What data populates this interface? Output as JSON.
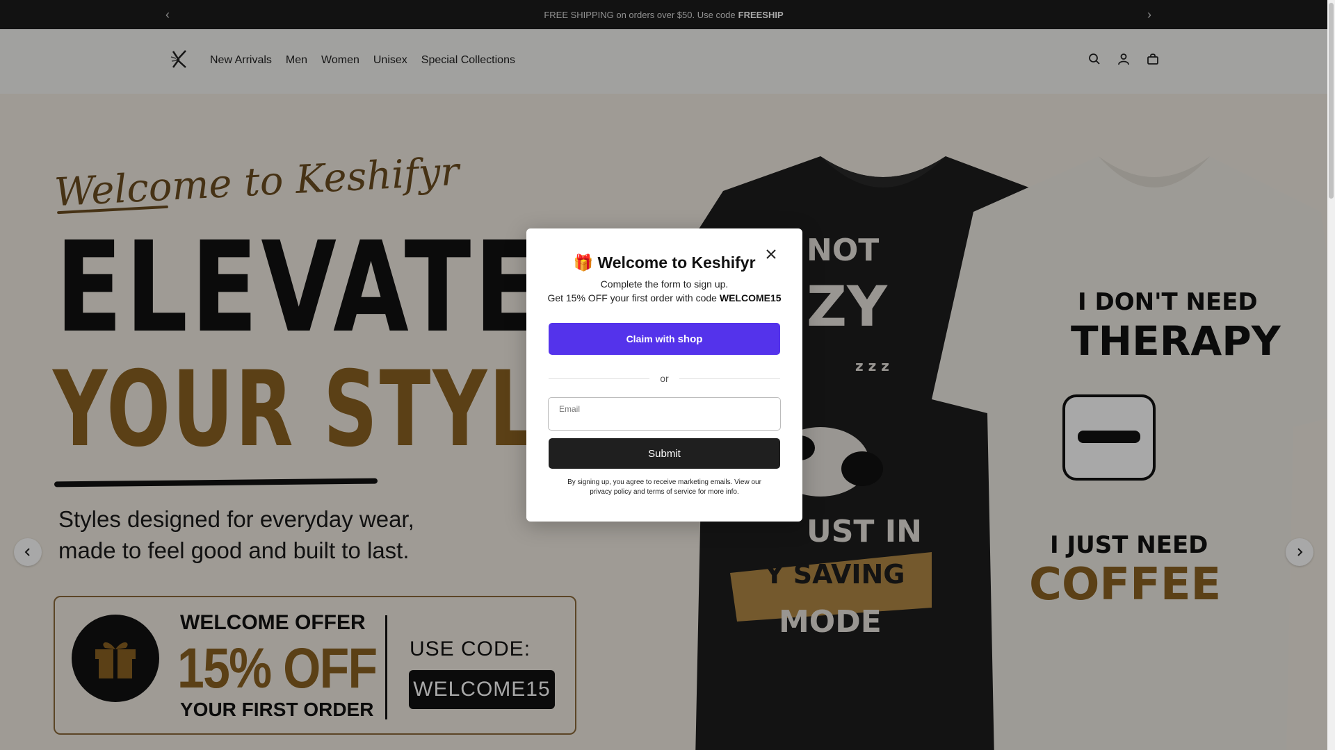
{
  "announcement": {
    "text": "FREE SHIPPING on orders over $50. Use code",
    "code": "FREESHIP",
    "prev_icon": "chevron-left-icon",
    "next_icon": "chevron-right-icon"
  },
  "header": {
    "logo": "keshifyr-logo",
    "nav": [
      "New Arrivals",
      "Men",
      "Women",
      "Unisex",
      "Special Collections"
    ],
    "icons": [
      "search-icon",
      "account-icon",
      "cart-icon"
    ]
  },
  "hero": {
    "script": "Welcome to Keshifyr",
    "headline_1": "ELEVATE",
    "headline_2": "YOUR STYLE",
    "subtitle_1": "Styles designed for everyday wear,",
    "subtitle_2": "made to feel good and built to last.",
    "offer": {
      "label": "WELCOME OFFER",
      "percent": "15% OFF",
      "line3": "YOUR FIRST ORDER",
      "use_code": "USE CODE:",
      "code": "WELCOME15"
    },
    "dark_shirt": {
      "top": "NOT",
      "mid": "ZY",
      "zzz": "z z z",
      "just": "UST IN",
      "saving": "Y SAVING",
      "mode": "MODE"
    },
    "light_shirt": {
      "l1": "I DON'T NEED",
      "l2": "THERAPY",
      "l3": "I JUST NEED",
      "l4": "COFFEE"
    }
  },
  "modal": {
    "gift_emoji": "🎁",
    "title": "Welcome to Keshifyr",
    "desc_1": "Complete the form to sign up.",
    "desc_2": "Get 15% OFF your first order with code",
    "desc_code": "WELCOME15",
    "shop_button_claim": "Claim with",
    "shop_button_brand": "shop",
    "or": "or",
    "email_placeholder": "Email",
    "submit": "Submit",
    "legal": "By signing up, you agree to receive marketing emails. View our privacy policy and terms of service for more info."
  },
  "colors": {
    "shop_purple": "#5433eb",
    "gold": "#8a6222",
    "announcement_bg": "#1c1c1c"
  }
}
